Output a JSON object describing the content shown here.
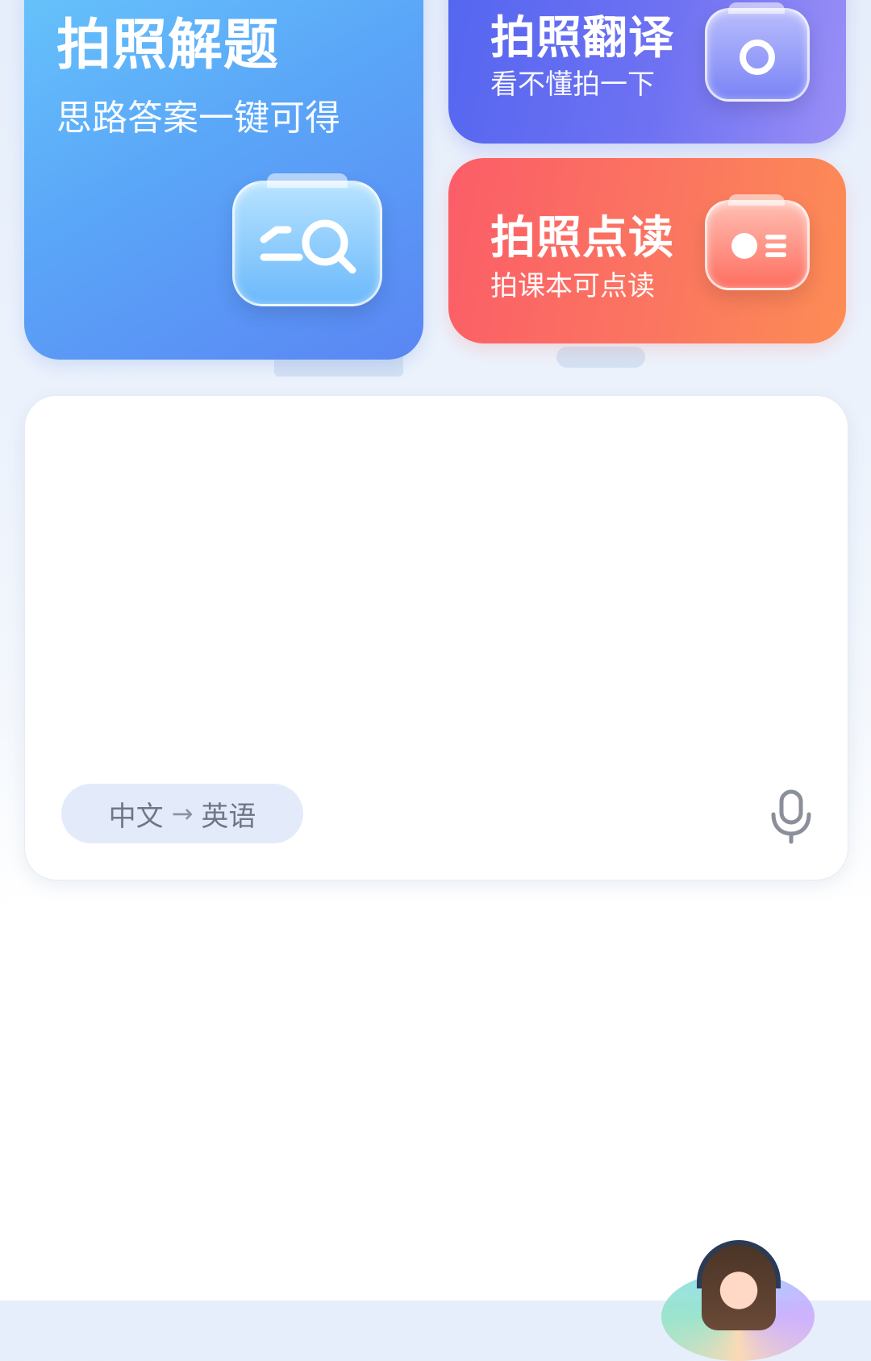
{
  "features": {
    "solve": {
      "title": "拍照解题",
      "subtitle": "思路答案一键可得",
      "icon": "camera-search-icon"
    },
    "translate": {
      "title": "拍照翻译",
      "subtitle": "看不懂拍一下",
      "icon": "camera-icon"
    },
    "read": {
      "title": "拍照点读",
      "subtitle": "拍课本可点读",
      "icon": "camera-read-icon"
    }
  },
  "translator": {
    "input_value": "",
    "source_lang": "中文",
    "arrow": "→",
    "target_lang": "英语",
    "mic_icon": "microphone-icon"
  },
  "assistant": {
    "icon": "assistant-avatar-icon"
  },
  "colors": {
    "solve_card": "#5aa6f8",
    "translate_card": "#6f72f2",
    "read_card": "#fb7660",
    "lang_pill": "#e3ebfb"
  }
}
